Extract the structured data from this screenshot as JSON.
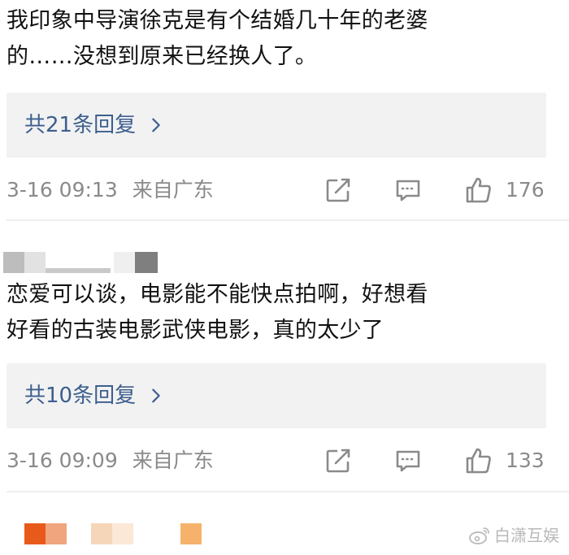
{
  "comments": [
    {
      "text_line1": "我印象中导演徐克是有个结婚几十年的老婆",
      "text_line2": "的……没想到原来已经换人了。",
      "replies_label": "共21条回复",
      "timestamp": "3-16 09:13",
      "location": "来自广东",
      "like_count": "176"
    },
    {
      "text_line1": "恋爱可以谈，电影能不能快点拍啊，好想看",
      "text_line2": "好看的古装电影武侠电影，真的太少了",
      "replies_label": "共10条回复",
      "timestamp": "3-16 09:09",
      "location": "来自广东",
      "like_count": "133"
    }
  ],
  "watermark": {
    "text": "白潇互娱",
    "icon": "weibo-logo-icon"
  },
  "colors": {
    "link": "#3d5f8f",
    "meta_gray": "#8a8a8a",
    "reply_box_bg": "#f2f2f2"
  }
}
